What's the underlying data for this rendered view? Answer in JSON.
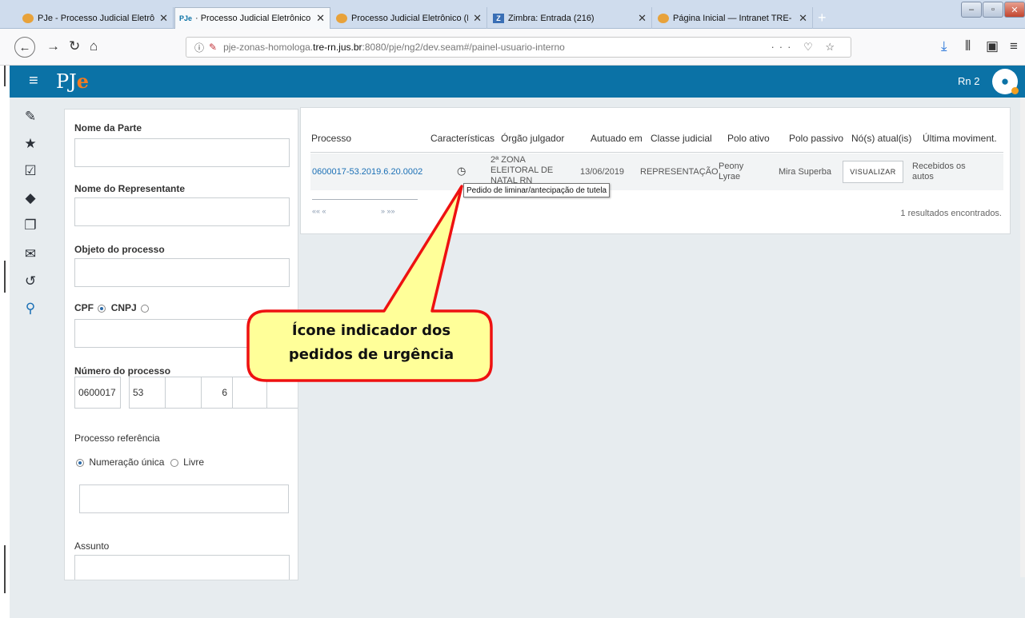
{
  "browser": {
    "tabs": [
      {
        "title": "PJe - Processo Judicial Eletrônic",
        "favicon": "P",
        "active": false
      },
      {
        "title": "· Processo Judicial Eletrônico",
        "favicon": "PJe",
        "active": true
      },
      {
        "title": "Processo Judicial Eletrônico (P",
        "favicon": "P",
        "active": false
      },
      {
        "title": "Zimbra: Entrada (216)",
        "favicon": "Z",
        "active": false
      },
      {
        "title": "Página Inicial — Intranet TRE-",
        "favicon": "P",
        "active": false
      }
    ],
    "url_prefix": "pje-zonas-homologa.",
    "url_domain": "tre-rn.jus.br",
    "url_suffix": ":8080/pje/ng2/dev.seam#/painel-usuario-interno"
  },
  "app": {
    "logo_main": "PJ",
    "logo_accent": "e",
    "user": "Rn 2"
  },
  "filters": {
    "nome_parte": "Nome da Parte",
    "nome_representante": "Nome do Representante",
    "objeto_processo": "Objeto do processo",
    "cpf": "CPF",
    "cnpj": "CNPJ",
    "numero_processo": "Número do processo",
    "numero_segments": [
      "0600017",
      "53",
      "",
      "6",
      "",
      ""
    ],
    "processo_referencia": "Processo referência",
    "numeracao_unica": "Numeração única",
    "livre": "Livre",
    "assunto": "Assunto"
  },
  "results": {
    "columns": [
      "Processo",
      "Características",
      "Órgão julgador",
      "Autuado em",
      "Classe judicial",
      "Polo ativo",
      "Polo passivo",
      "Nó(s) atual(is)",
      "Última moviment."
    ],
    "row": {
      "processo": "0600017-53.2019.6.20.0002",
      "orgao_line1": "2ª ZONA",
      "orgao_line2": "ELEITORAL DE",
      "orgao_line3": "NATAL RN",
      "autuado": "13/06/2019",
      "classe": "REPRESENTAÇÃO",
      "polo_ativo_1": "Peony",
      "polo_ativo_2": "Lyrae",
      "polo_passivo": "Mira Superba",
      "no_atual": "VISUALIZAR",
      "ultima_1": "Recebidos os",
      "ultima_2": "autos"
    },
    "pager": "«« «",
    "pager_next": "» »»",
    "count": "1 resultados encontrados.",
    "tooltip": "Pedido de liminar/antecipação de tutela"
  },
  "callout": {
    "line1": "Ícone indicador dos",
    "line2": "pedidos de urgência",
    "fill": "#ffff99",
    "stroke": "#ee1111"
  }
}
